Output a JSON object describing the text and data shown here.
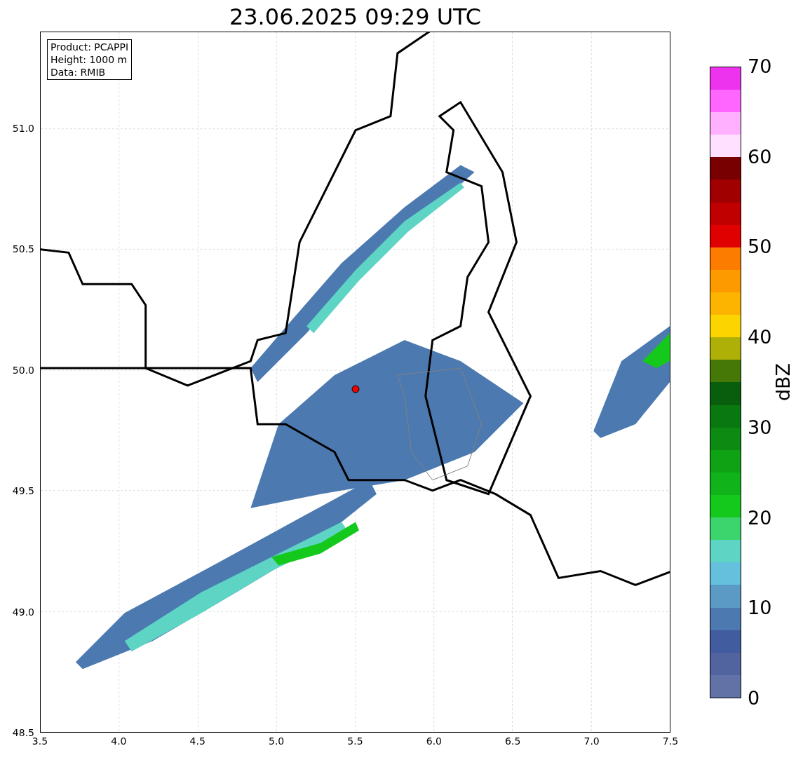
{
  "title": "23.06.2025 09:29 UTC",
  "info_box": {
    "lines": [
      "Product: PCAPPI",
      "Height: 1000 m",
      "Data: RMIB"
    ]
  },
  "map": {
    "xticks": [
      "3.5",
      "4.0",
      "4.5",
      "5.0",
      "5.5",
      "6.0",
      "6.5",
      "7.0",
      "7.5"
    ],
    "yticks": [
      "51.0",
      "50.5",
      "50.0",
      "49.5",
      "49.0",
      "48.5"
    ]
  },
  "colorbar": {
    "label": "dBZ",
    "ticks": [
      "70",
      "60",
      "50",
      "40",
      "30",
      "20",
      "10",
      "0"
    ],
    "segments": [
      {
        "color": "#6272a6"
      },
      {
        "color": "#5264a0"
      },
      {
        "color": "#425ca0"
      },
      {
        "color": "#4c7ab0"
      },
      {
        "color": "#5a9ac4"
      },
      {
        "color": "#64c0dc"
      },
      {
        "color": "#5ed4c4"
      },
      {
        "color": "#3cd46c"
      },
      {
        "color": "#14c81c"
      },
      {
        "color": "#10b41a"
      },
      {
        "color": "#0ea214"
      },
      {
        "color": "#0c8a12"
      },
      {
        "color": "#0a7810"
      },
      {
        "color": "#085e0c"
      },
      {
        "color": "#467808"
      },
      {
        "color": "#aeb008"
      },
      {
        "color": "#fcd400"
      },
      {
        "color": "#fcb400"
      },
      {
        "color": "#fc9a00"
      },
      {
        "color": "#fc7c00"
      },
      {
        "color": "#e00000"
      },
      {
        "color": "#c00000"
      },
      {
        "color": "#a00000"
      },
      {
        "color": "#780000"
      },
      {
        "color": "#ffe0ff"
      },
      {
        "color": "#ffb0ff"
      },
      {
        "color": "#ff66ff"
      },
      {
        "color": "#ee33ee"
      }
    ]
  }
}
